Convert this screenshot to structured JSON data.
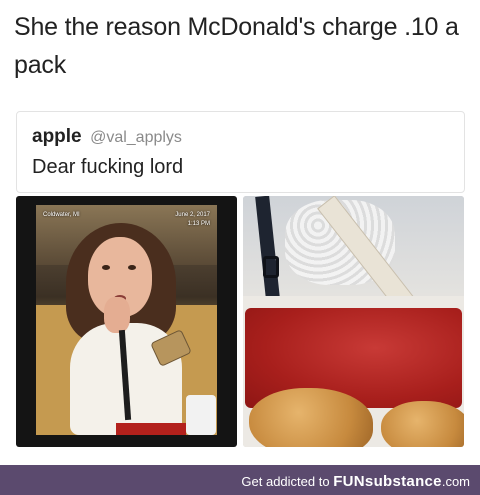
{
  "meme": {
    "caption": "She the reason McDonald's charge .10 a pack"
  },
  "tweet": {
    "display_name": "apple",
    "handle": "@val_applys",
    "text": "Dear fucking lord"
  },
  "photo_left": {
    "location": "Coldwater, MI",
    "date": "June 2, 2017",
    "time": "1:13 PM"
  },
  "footer": {
    "prefix": "Get addicted to",
    "site": "FUNsubstance",
    "suffix": ".com",
    "bar_color": "#5b4a6e"
  }
}
